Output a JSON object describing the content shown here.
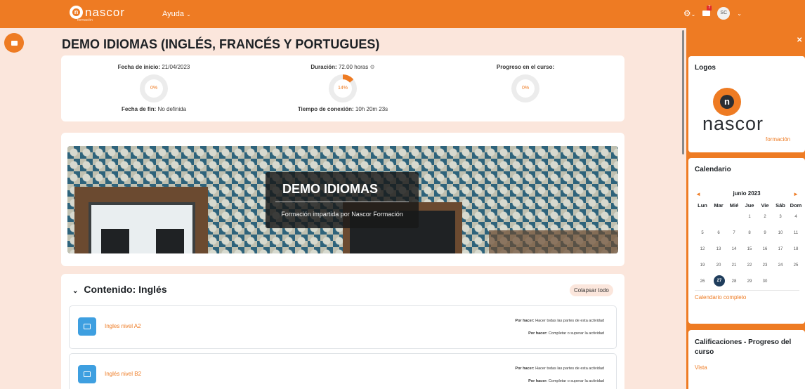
{
  "navbar": {
    "logo_text": "nascor",
    "logo_sub": "formación",
    "help_label": "Ayuda",
    "notification_count": "7",
    "user_initials": "SC"
  },
  "page": {
    "title": "DEMO IDIOMAS (INGLÉS, FRANCÉS Y PORTUGUES)"
  },
  "info": {
    "start_label": "Fecha de inicio:",
    "start_value": "21/04/2023",
    "end_label": "Fecha de fin:",
    "end_value": "No definida",
    "duration_label": "Duración:",
    "duration_value": "72.00 horas",
    "connection_label": "Tiempo de conexión:",
    "connection_value": "10h 20m 23s",
    "progress_label": "Progreso en el curso:",
    "rings": [
      {
        "text": "0%",
        "fraction": 0
      },
      {
        "text": "14%",
        "fraction": 0.14
      },
      {
        "text": "0%",
        "fraction": 0
      }
    ]
  },
  "banner": {
    "title": "DEMO IDIOMAS",
    "subtitle": "Formación impartida por Nascor Formación"
  },
  "content": {
    "section_title": "Contenido: Inglés",
    "collapse_label": "Colapsar todo",
    "activities": [
      {
        "name": "Ingles nivel A2",
        "req1_label": "Por hacer:",
        "req1_text": "Hacer todas las partes de esta actividad",
        "req2_label": "Por hacer:",
        "req2_text": "Completar o superar la actividad"
      },
      {
        "name": "Inglés nivel B2",
        "req1_label": "Por hacer:",
        "req1_text": "Hacer todas las partes de esta actividad",
        "req2_label": "Por hacer:",
        "req2_text": "Completar o superar la actividad"
      }
    ]
  },
  "drawer": {
    "logos_title": "Logos",
    "logo_word": "nascor",
    "logo_sub": "formación",
    "calendar_title": "Calendario",
    "month": "junio 2023",
    "prev": "◄",
    "next": "►",
    "weekdays": [
      "Lun",
      "Mar",
      "Mié",
      "Jue",
      "Vie",
      "Sáb",
      "Dom"
    ],
    "weeks": [
      [
        "",
        "",
        "",
        "1",
        "2",
        "3",
        "4"
      ],
      [
        "5",
        "6",
        "7",
        "8",
        "9",
        "10",
        "11"
      ],
      [
        "12",
        "13",
        "14",
        "15",
        "16",
        "17",
        "18"
      ],
      [
        "19",
        "20",
        "21",
        "22",
        "23",
        "24",
        "25"
      ],
      [
        "26",
        "27",
        "28",
        "29",
        "30",
        "",
        ""
      ]
    ],
    "today": "27",
    "calendar_link": "Calendario completo",
    "grades_title": "Calificaciones - Progreso del curso",
    "grades_link": "Vista"
  },
  "colors": {
    "accent": "#ee7b23",
    "background": "#fbe6dc",
    "today": "#1f3d5c",
    "activity_icon": "#3e9fe0"
  },
  "icons": [
    "gear-icon",
    "message-icon",
    "drawer-icon",
    "close-icon",
    "chevron-down-icon",
    "info-icon",
    "assignment-icon"
  ]
}
